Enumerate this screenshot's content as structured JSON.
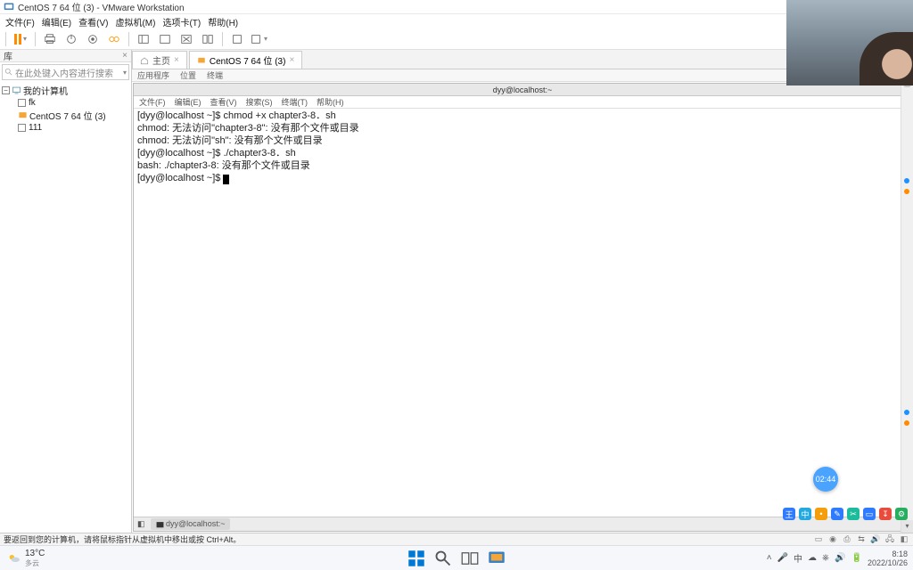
{
  "window": {
    "title": "CentOS 7 64 位 (3) - VMware Workstation"
  },
  "menubar": {
    "items": [
      "文件(F)",
      "编辑(E)",
      "查看(V)",
      "虚拟机(M)",
      "选项卡(T)",
      "帮助(H)"
    ]
  },
  "library": {
    "title": "库",
    "close": "×",
    "search_placeholder": "在此处键入内容进行搜索",
    "root": "我的计算机",
    "items": [
      "fk",
      "CentOS 7 64 位 (3)",
      "111"
    ]
  },
  "tabs": {
    "home": "主页",
    "active": "CentOS 7 64 位 (3)",
    "close": "×"
  },
  "subbar": {
    "items": [
      "应用程序",
      "位置",
      "终端"
    ]
  },
  "vm": {
    "title": "dyy@localhost:~",
    "menus": [
      "文件(F)",
      "编辑(E)",
      "查看(V)",
      "搜索(S)",
      "终端(T)",
      "帮助(H)"
    ],
    "bottom": "dyy@localhost:~"
  },
  "terminal": {
    "l1": "[dyy@localhost ~]$ chmod +x chapter3-8．sh",
    "l2": "chmod: 无法访问\"chapter3-8\": 没有那个文件或目录",
    "l3": "chmod: 无法访问\"sh\": 没有那个文件或目录",
    "l4": "[dyy@localhost ~]$ ./chapter3-8．sh",
    "l5": "bash: ./chapter3-8: 没有那个文件或目录",
    "l6": "[dyy@localhost ~]$ "
  },
  "status": {
    "text": "要返回到您的计算机，请将鼠标指针从虚拟机中移出或按 Ctrl+Alt。"
  },
  "timer": {
    "value": "02:44"
  },
  "taskbar": {
    "temp": "13°C",
    "cond": "多云",
    "time": "8:18",
    "date": "2022/10/26"
  }
}
